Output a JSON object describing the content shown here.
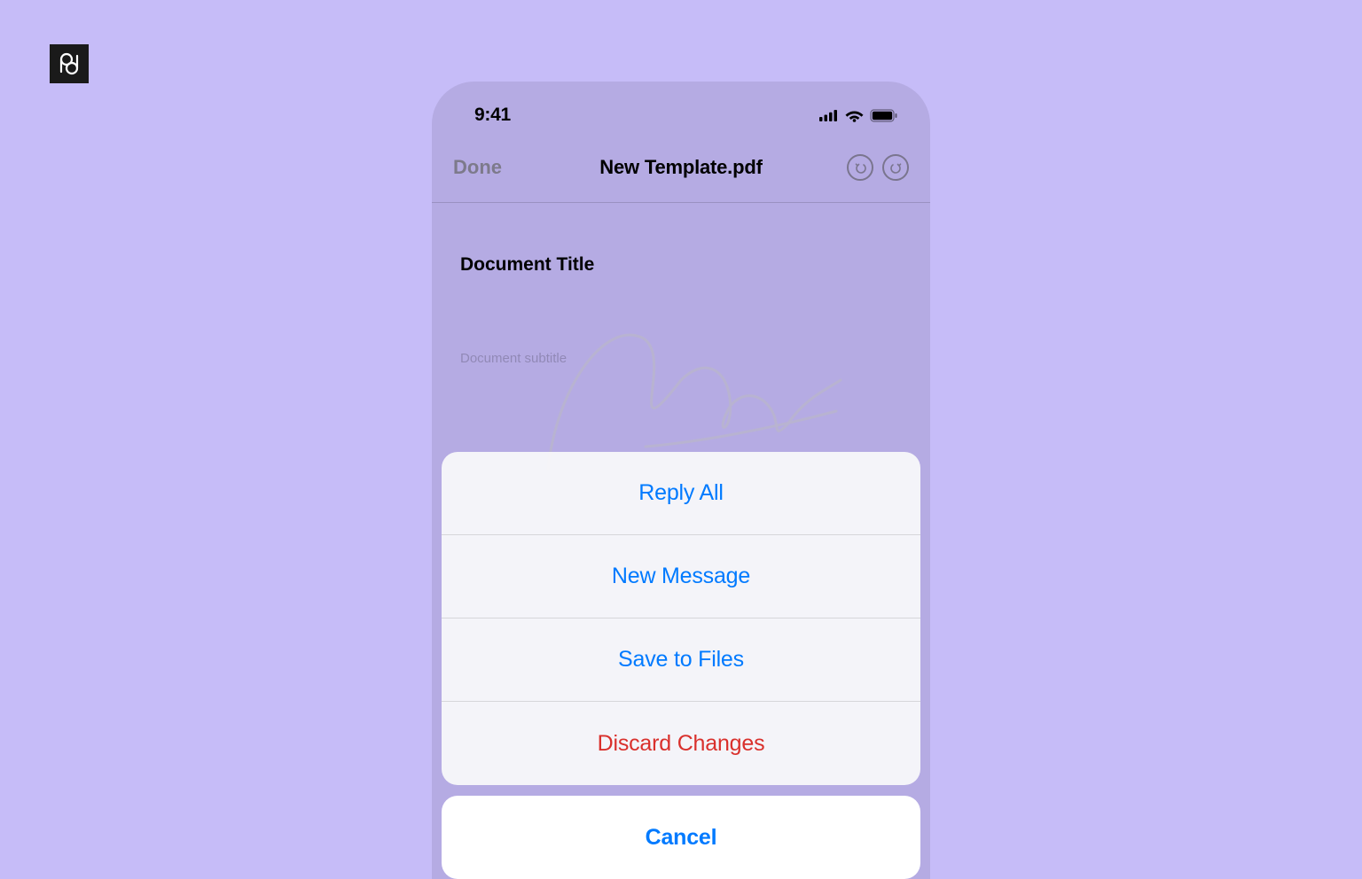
{
  "logo": {
    "tooltip": "pd"
  },
  "statusBar": {
    "time": "9:41"
  },
  "navBar": {
    "done": "Done",
    "title": "New Template.pdf"
  },
  "document": {
    "titleLabel": "Document Title",
    "subtitlePlaceholder": "Document subtitle"
  },
  "actionSheet": {
    "items": [
      {
        "label": "Reply All",
        "style": "default"
      },
      {
        "label": "New Message",
        "style": "default"
      },
      {
        "label": "Save to Files",
        "style": "default"
      },
      {
        "label": "Discard Changes",
        "style": "destructive"
      }
    ],
    "cancel": "Cancel"
  }
}
